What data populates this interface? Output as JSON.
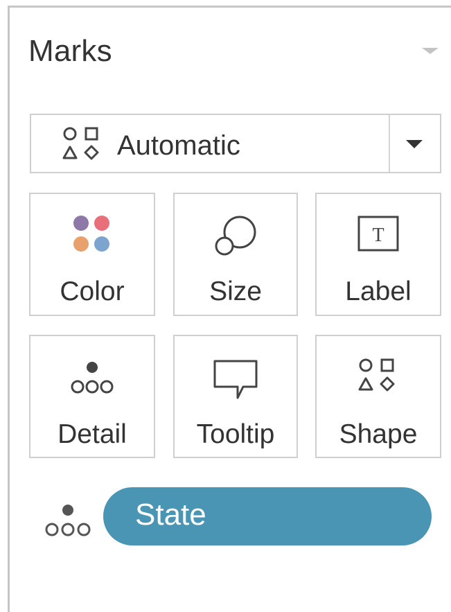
{
  "marks_card": {
    "title": "Marks",
    "mark_type": {
      "selected": "Automatic",
      "icon": "shapes-icon"
    },
    "encodings": [
      {
        "id": "color",
        "label": "Color",
        "icon": "color-dots-icon"
      },
      {
        "id": "size",
        "label": "Size",
        "icon": "size-circles-icon"
      },
      {
        "id": "label",
        "label": "Label",
        "icon": "text-label-icon"
      },
      {
        "id": "detail",
        "label": "Detail",
        "icon": "detail-dots-icon"
      },
      {
        "id": "tooltip",
        "label": "Tooltip",
        "icon": "speech-bubble-icon"
      },
      {
        "id": "shape",
        "label": "Shape",
        "icon": "shapes-icon"
      }
    ],
    "fields": [
      {
        "encoding_icon": "detail-dots-icon",
        "name": "State",
        "color": "#4a95b4"
      }
    ],
    "colors": {
      "dot_purple": "#8e78a8",
      "dot_red": "#e8707a",
      "dot_orange": "#e8a06c",
      "dot_blue": "#7da3cf",
      "pill": "#4a95b4"
    }
  }
}
